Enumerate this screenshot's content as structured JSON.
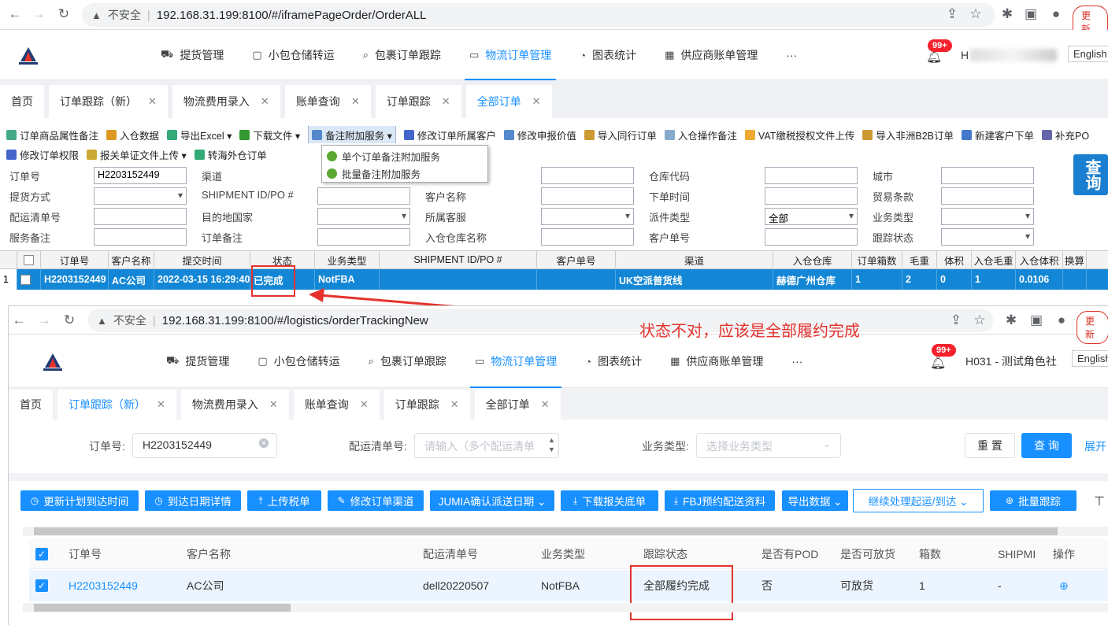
{
  "top": {
    "chrome": {
      "insecure": "不安全",
      "url": "192.168.31.199:8100/#/iframePageOrder/OrderALL",
      "update": "更新"
    },
    "nav": [
      {
        "icon": "truck-icon",
        "glyph": "⛟",
        "label": "提货管理"
      },
      {
        "icon": "box-icon",
        "glyph": "▢",
        "label": "小包仓储转运"
      },
      {
        "icon": "search-icon",
        "glyph": "⌕",
        "label": "包裹订单跟踪"
      },
      {
        "icon": "folder-icon",
        "glyph": "▭",
        "label": "物流订单管理"
      },
      {
        "icon": "chart-icon",
        "glyph": "◔",
        "label": "图表统计"
      },
      {
        "icon": "calendar-icon",
        "glyph": "▦",
        "label": "供应商账单管理"
      },
      {
        "icon": "more-icon",
        "glyph": "",
        "label": "···"
      }
    ],
    "badge": "99+",
    "user": "H",
    "lang": "English",
    "tabs": [
      {
        "label": "首页",
        "close": ""
      },
      {
        "label": "订单跟踪（新）",
        "close": "✕"
      },
      {
        "label": "物流费用录入",
        "close": "✕"
      },
      {
        "label": "账单查询",
        "close": "✕"
      },
      {
        "label": "订单跟踪",
        "close": "✕"
      },
      {
        "label": "全部订单",
        "close": "✕"
      }
    ],
    "toolbar1": [
      "订单商品属性备注",
      "入仓数据",
      "导出Excel ▾",
      "下载文件 ▾",
      "备注附加服务 ▾",
      "修改订单所属客户",
      "修改申报价值",
      "导入同行订单",
      "入仓操作备注",
      "VAT缴税授权文件上传",
      "导入非洲B2B订单",
      "新建客户下单",
      "补充PO"
    ],
    "toolbar2": [
      "修改订单权限",
      "报关单证文件上传 ▾",
      "转海外仓订单"
    ],
    "popup": [
      "单个订单备注附加服务",
      "批量备注附加服务"
    ],
    "form": {
      "order_no_label": "订单号",
      "order_no": "H2203152449",
      "channel_label": "渠道",
      "warehouse_code_label": "仓库代码",
      "city_label": "城市",
      "pickup_label": "提货方式",
      "shipment_label": "SHIPMENT ID/PO #",
      "customer_name_label": "客户名称",
      "order_time_label": "下单时间",
      "trade_label": "贸易条款",
      "dist_label": "配运清单号",
      "dest_label": "目的地国家",
      "service_label": "所属客服",
      "dispatch_label": "派件类型",
      "dispatch_value": "全部",
      "biz_label": "业务类型",
      "svc_note_label": "服务备注",
      "order_note_label": "订单备注",
      "in_wh_label": "入仓仓库名称",
      "cust_no_label": "客户单号",
      "track_label": "跟踪状态",
      "query": "查询"
    },
    "grid_headers": [
      "订单号",
      "客户名称",
      "提交时间",
      "状态",
      "业务类型",
      "SHIPMENT ID/PO #",
      "客户单号",
      "渠道",
      "入仓仓库",
      "订单箱数",
      "毛重",
      "体积",
      "入仓毛重",
      "入仓体积",
      "换算"
    ],
    "grid_row": {
      "idx": "1",
      "cells": [
        "H2203152449",
        "AC公司",
        "2022-03-15 16:29:40",
        "已完成",
        "NotFBA",
        "",
        "",
        "UK空派普货线",
        "赫德广州仓库",
        "1",
        "2",
        "0",
        "1",
        "0.0106",
        ""
      ]
    }
  },
  "annotation": "状态不对，应该是全部履约完成",
  "bottom": {
    "chrome": {
      "insecure": "不安全",
      "url": "192.168.31.199:8100/#/logistics/orderTrackingNew",
      "update": "更新"
    },
    "badge": "99+",
    "user": "H031 - 测试角色社",
    "lang": "English",
    "tabs": [
      {
        "label": "首页",
        "close": ""
      },
      {
        "label": "订单跟踪（新）",
        "close": "✕"
      },
      {
        "label": "物流费用录入",
        "close": "✕"
      },
      {
        "label": "账单查询",
        "close": "✕"
      },
      {
        "label": "订单跟踪",
        "close": "✕"
      },
      {
        "label": "全部订单",
        "close": "✕"
      }
    ],
    "filter": {
      "order_label": "订单号:",
      "order_value": "H2203152449",
      "dist_label": "配运清单号:",
      "dist_placeholder": "请输入（多个配运清单",
      "biz_label": "业务类型:",
      "biz_placeholder": "选择业务类型",
      "reset": "重 置",
      "query": "查 询",
      "expand": "展开"
    },
    "actions": [
      {
        "icon": "clock-icon",
        "glyph": "◷",
        "label": "更新计划到达时间"
      },
      {
        "icon": "clock-icon",
        "glyph": "◷",
        "label": "到达日期详情"
      },
      {
        "icon": "upload-icon",
        "glyph": "⤒",
        "label": "上传税单"
      },
      {
        "icon": "edit-icon",
        "glyph": "✎",
        "label": "修改订单渠道"
      },
      {
        "icon": "",
        "glyph": "",
        "label": "JUMIA确认派送日期 ⌄"
      },
      {
        "icon": "download-icon",
        "glyph": "⤓",
        "label": "下载报关底单"
      },
      {
        "icon": "download-icon",
        "glyph": "⤓",
        "label": "FBJ预约配送资料"
      },
      {
        "icon": "",
        "glyph": "",
        "label": "导出数据 ⌄"
      },
      {
        "icon": "",
        "glyph": "",
        "label": "继续处理起运/到达 ⌄"
      },
      {
        "icon": "target-icon",
        "glyph": "⊕",
        "label": "批量跟踪"
      }
    ],
    "table_headers": [
      "订单号",
      "客户名称",
      "配运清单号",
      "业务类型",
      "跟踪状态",
      "是否有POD",
      "是否可放货",
      "箱数",
      "SHIPMI",
      "操作"
    ],
    "table_row": [
      "H2203152449",
      "AC公司",
      "dell20220507",
      "NotFBA",
      "全部履约完成",
      "否",
      "可放货",
      "1",
      "-",
      ""
    ]
  }
}
